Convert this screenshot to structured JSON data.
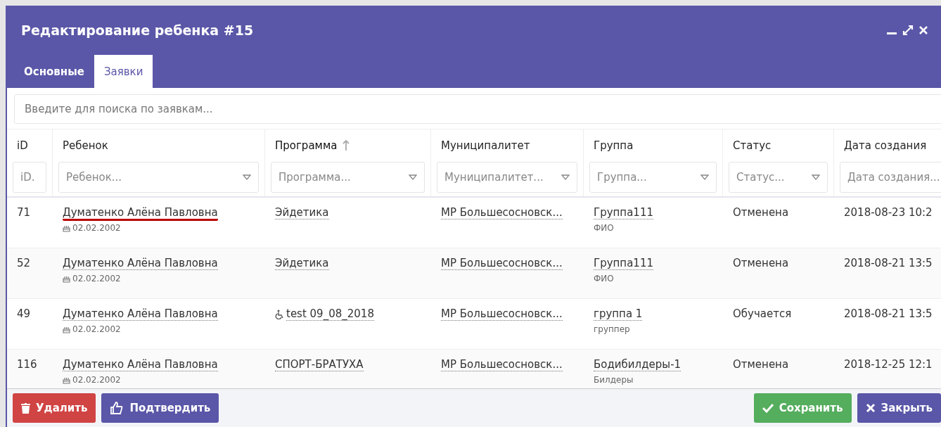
{
  "window": {
    "title": "Редактирование ребенка #15"
  },
  "tabs": [
    {
      "label": "Основные",
      "selected": false
    },
    {
      "label": "Заявки",
      "selected": true
    }
  ],
  "search": {
    "placeholder": "Введите для поиска по заявкам..."
  },
  "table": {
    "columns": [
      {
        "label": "iD",
        "filter_placeholder": "iD.",
        "dropdown": false,
        "sorted": false
      },
      {
        "label": "Ребенок",
        "filter_placeholder": "Ребенок...",
        "dropdown": true,
        "sorted": false
      },
      {
        "label": "Программа",
        "filter_placeholder": "Программа...",
        "dropdown": true,
        "sorted": true
      },
      {
        "label": "Муниципалитет",
        "filter_placeholder": "Муниципалитет...",
        "dropdown": true,
        "sorted": false
      },
      {
        "label": "Группа",
        "filter_placeholder": "Группа...",
        "dropdown": true,
        "sorted": false
      },
      {
        "label": "Статус",
        "filter_placeholder": "Статус...",
        "dropdown": true,
        "sorted": false
      },
      {
        "label": "Дата создания",
        "filter_placeholder": "Дата создания...",
        "dropdown": false,
        "sorted": false
      }
    ],
    "rows": [
      {
        "id": "71",
        "child": "Думатенко Алёна Павловна",
        "birth_date": "02.02.2002",
        "highlighted": true,
        "program": "Эйдетика",
        "accessible": false,
        "municipality": "МР Большесосновск...",
        "group": "Группа111",
        "group_note": "ФИО",
        "status": "Отменена",
        "created": "2018-08-23 10:2"
      },
      {
        "id": "52",
        "child": "Думатенко Алёна Павловна",
        "birth_date": "02.02.2002",
        "highlighted": false,
        "program": "Эйдетика",
        "accessible": false,
        "municipality": "МР Большесосновск...",
        "group": "Группа111",
        "group_note": "ФИО",
        "status": "Отменена",
        "created": "2018-08-21 13:5"
      },
      {
        "id": "49",
        "child": "Думатенко Алёна Павловна",
        "birth_date": "02.02.2002",
        "highlighted": false,
        "program": "test 09_08_2018",
        "accessible": true,
        "municipality": "МР Большесосновск...",
        "group": "группа 1",
        "group_note": "группер",
        "status": "Обучается",
        "created": "2018-08-21 13:5"
      },
      {
        "id": "116",
        "child": "Думатенко Алёна Павловна",
        "birth_date": "02.02.2002",
        "highlighted": false,
        "program": "СПОРТ-БРАТУХА",
        "accessible": false,
        "municipality": "МР Большесосновск...",
        "group": "Бодибилдеры-1",
        "group_note": "Билдеры",
        "status": "Отменена",
        "created": "2018-12-25 12:1"
      }
    ]
  },
  "footer": {
    "left_buttons": [
      {
        "label": "Удалить",
        "kind": "danger"
      },
      {
        "label": "Подтвердить",
        "kind": "confirm"
      }
    ],
    "right_buttons": [
      {
        "label": "Сохранить",
        "kind": "save"
      },
      {
        "label": "Закрыть",
        "kind": "close"
      }
    ]
  }
}
